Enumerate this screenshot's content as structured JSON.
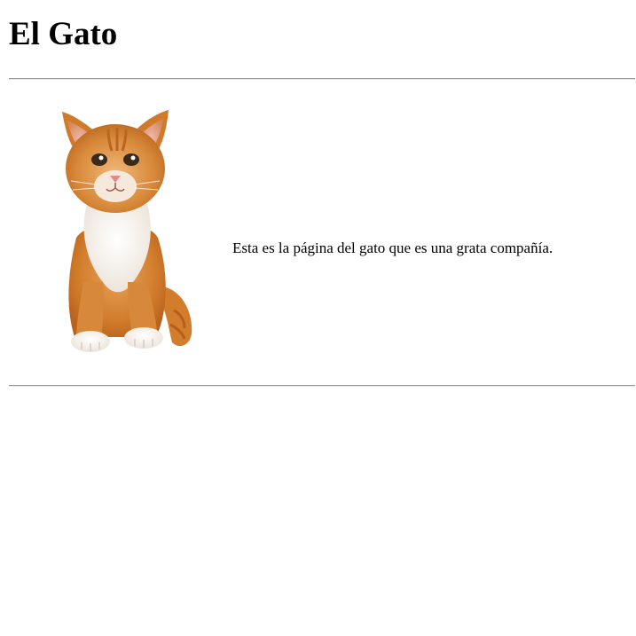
{
  "page": {
    "title": "El Gato",
    "description": "Esta es la página del gato que es una grata compañía."
  },
  "image": {
    "icon": "kitten-photo"
  },
  "colors": {
    "background": "#ffffff",
    "text": "#000000",
    "rule": "#9a9a9a",
    "fur_orange": "#d9872e",
    "fur_white": "#f7f3ee"
  }
}
